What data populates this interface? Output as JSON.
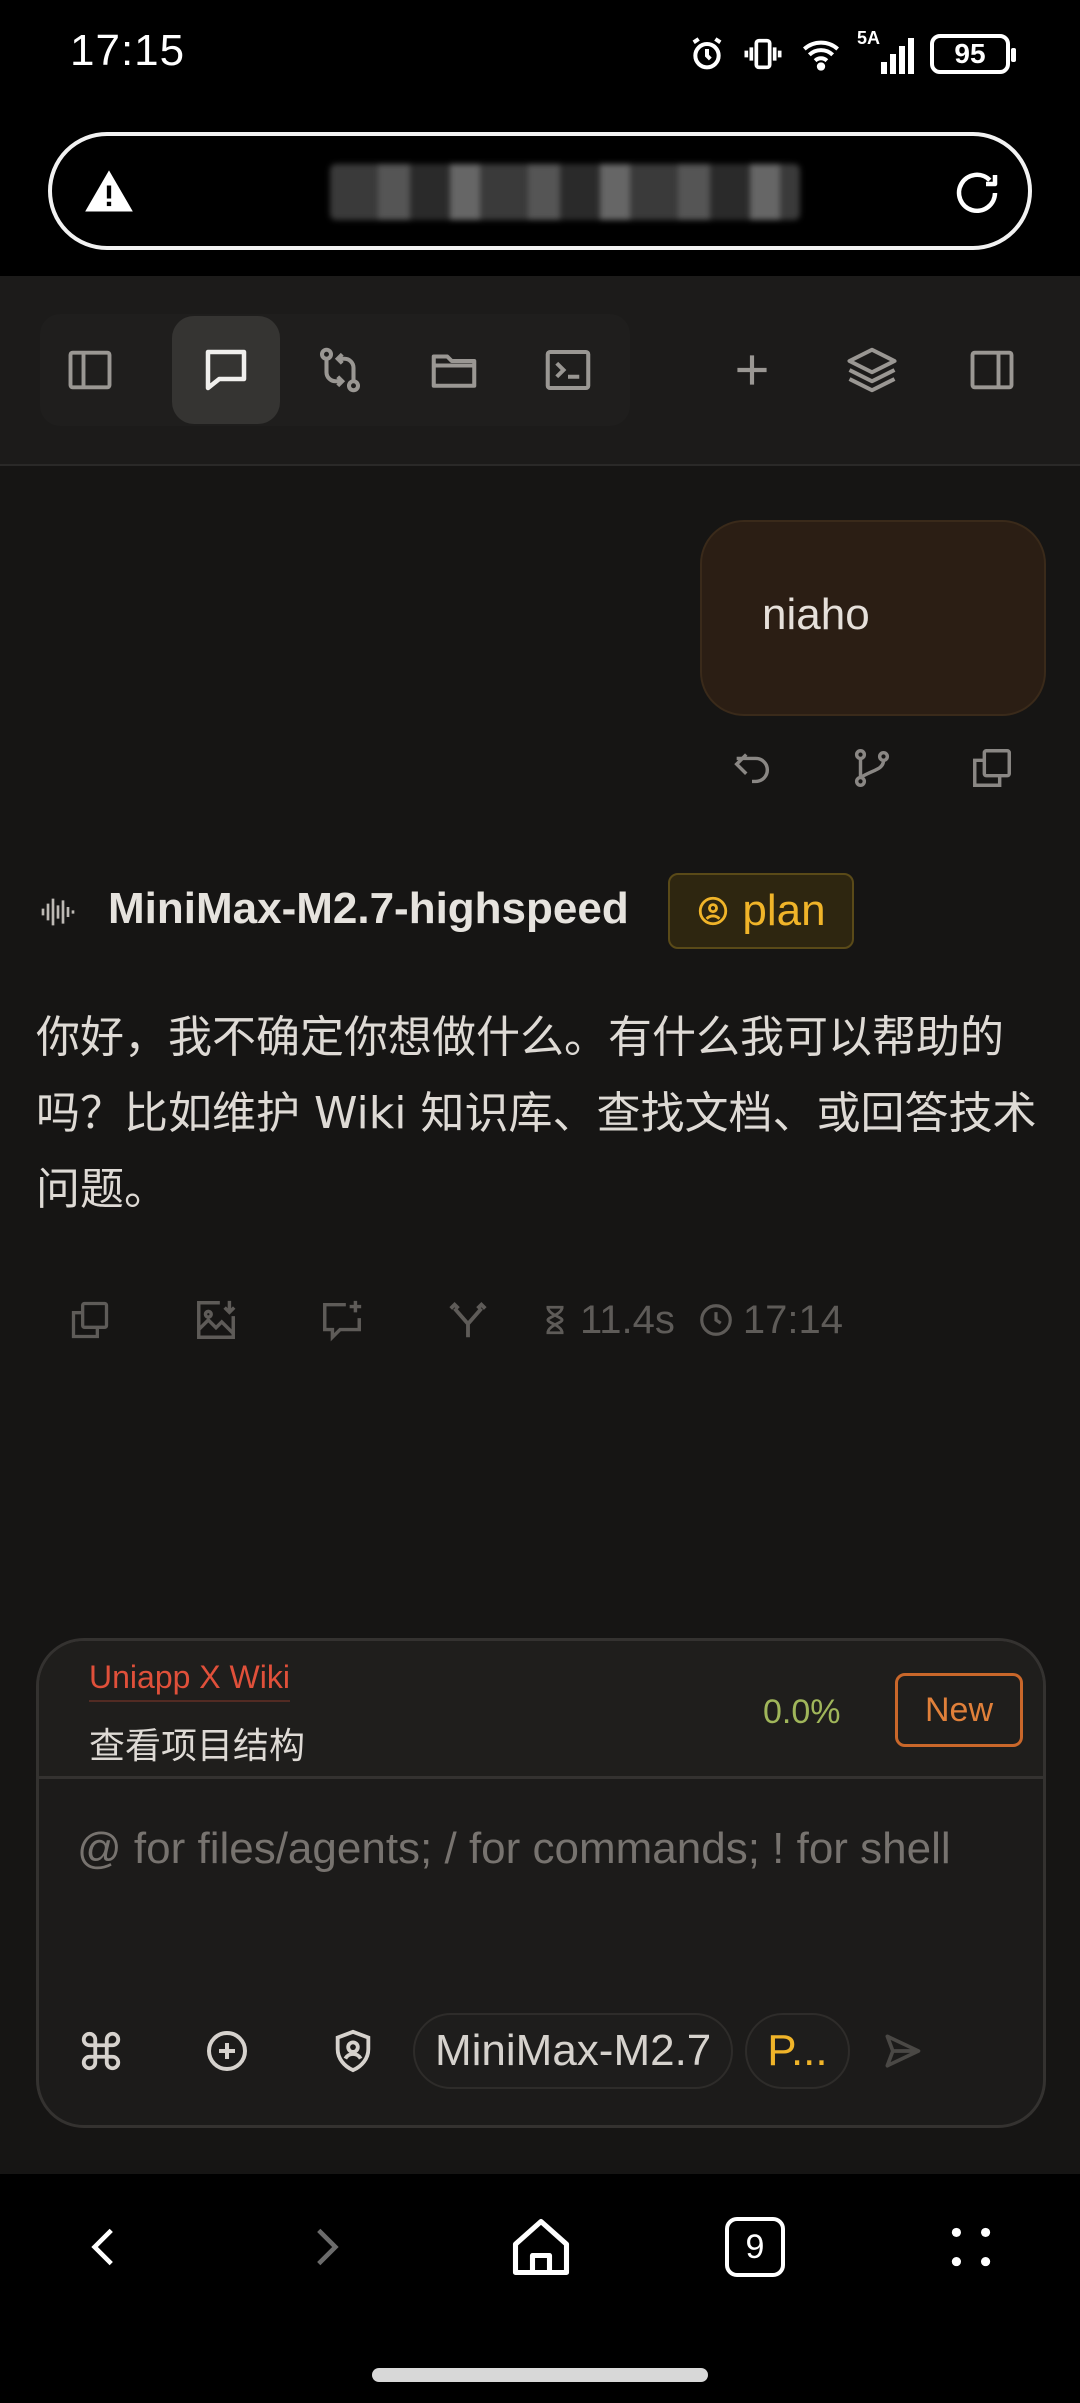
{
  "status_bar": {
    "time": "17:15",
    "battery": "95",
    "network": "5A"
  },
  "url_bar": {
    "warning": "not-secure-icon",
    "reload": "reload-icon"
  },
  "toolbar": {
    "items": [
      {
        "name": "toggle-sidebar",
        "icon": "sidebar-icon"
      },
      {
        "name": "chat",
        "icon": "chat-icon",
        "active": true
      },
      {
        "name": "source-control",
        "icon": "git-compare-icon"
      },
      {
        "name": "files",
        "icon": "folder-icon"
      },
      {
        "name": "terminal",
        "icon": "terminal-icon"
      },
      {
        "name": "new",
        "icon": "plus-icon"
      },
      {
        "name": "layers",
        "icon": "layers-icon"
      },
      {
        "name": "right-panel",
        "icon": "panel-right-icon"
      }
    ]
  },
  "conversation": {
    "user_message": "niaho",
    "model_name": "MiniMax-M2.7-highspeed",
    "mode_badge": "plan",
    "assistant_message": "你好，我不确定你想做什么。有什么我可以帮助的吗？比如维护 Wiki 知识库、查找文档、或回答技术问题。",
    "duration": "11.4s",
    "timestamp": "17:14"
  },
  "composer": {
    "project": "Uniapp X Wiki",
    "session_title": "查看项目结构",
    "progress": "0.0%",
    "new_label": "New",
    "placeholder": "@ for files/agents; / for commands; ! for shell",
    "model": "MiniMax-M2.7",
    "mode": "P..."
  },
  "nav": {
    "tab_count": "9"
  },
  "colors": {
    "accent": "#f0b429",
    "background": "#161514",
    "user_bubble": "#2b1e14",
    "project": "#e0503a",
    "progress": "#a0b65a",
    "new": "#c9672a"
  }
}
